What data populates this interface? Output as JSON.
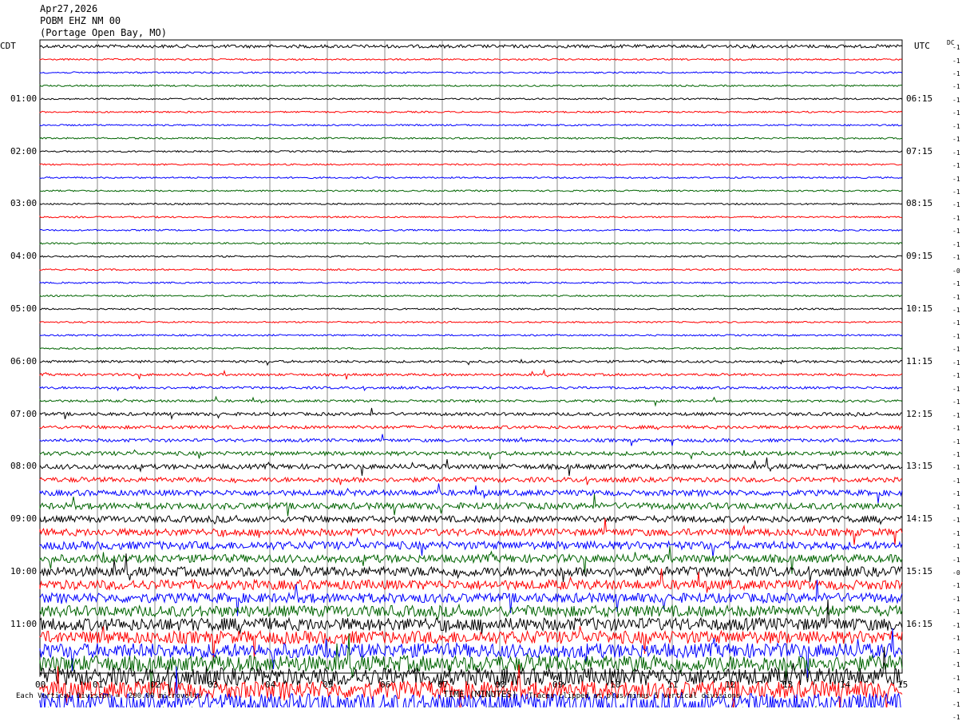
{
  "header": {
    "date": "Apr27,2026",
    "station": "POBM EHZ NM 00",
    "location": "(Portage Open Bay, MO)"
  },
  "left_tz": "CDT",
  "right_tz": "UTC",
  "dc_header": "DC",
  "left_labels": [
    "01:00",
    "02:00",
    "03:00",
    "04:00",
    "05:00",
    "06:00",
    "07:00",
    "08:00",
    "09:00",
    "10:00",
    "11:00"
  ],
  "right_labels": [
    "06:15",
    "07:15",
    "08:15",
    "09:15",
    "10:15",
    "11:15",
    "12:15",
    "13:15",
    "14:15",
    "15:15",
    "16:15"
  ],
  "dc_values": [
    "-1",
    "-1",
    "-1",
    "-1",
    "-1",
    "-1",
    "-1",
    "-1",
    "-1",
    "-1",
    "-1",
    "-1",
    "-1",
    "-1",
    "-1",
    "-1",
    "-1",
    "-0",
    "-1",
    "-1",
    "-1",
    "-1",
    "-1",
    "-1",
    "-1",
    "-1",
    "-1",
    "-1",
    "-1",
    "-1",
    "-1",
    "-1",
    "-1",
    "-1",
    "-1",
    "-1",
    "-1",
    "-1",
    "-1",
    "-1",
    "-0",
    "-1",
    "-1",
    "-1",
    "-1",
    "-1",
    "-1",
    "-1",
    "-1",
    "-1",
    "-1",
    "-1"
  ],
  "x_ticks": [
    "00",
    "01",
    "02",
    "03",
    "04",
    "05",
    "06",
    "07",
    "08",
    "09",
    "10",
    "11",
    "12",
    "13",
    "14",
    "15"
  ],
  "x_axis_label": "TIME (MINUTES)",
  "footer_left": "Each Vertical Division =  200.00 microvolts",
  "footer_right": "Traces clipped at plus/minus 5 vertical divisions",
  "trace_colors": [
    "#000000",
    "#ff0000",
    "#0000ff",
    "#006400"
  ],
  "trace_noise_levels": [
    2,
    1,
    1,
    1,
    1,
    1,
    1,
    1,
    1,
    1,
    1,
    1,
    1,
    1,
    1,
    1,
    1,
    1,
    1,
    1,
    1,
    1,
    1,
    1,
    1.5,
    1.5,
    1.5,
    1.5,
    2,
    2,
    2,
    2.5,
    3,
    3,
    3.5,
    4,
    4,
    4.5,
    5,
    5,
    6,
    6,
    6,
    7,
    8,
    8,
    9,
    10,
    11,
    11,
    12,
    12
  ]
}
